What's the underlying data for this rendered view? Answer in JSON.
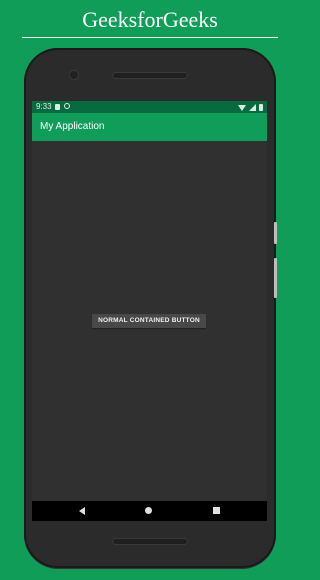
{
  "header": {
    "title": "GeeksforGeeks"
  },
  "device": {
    "status_bar": {
      "time": "9:33"
    },
    "app_bar": {
      "title": "My Application"
    },
    "main": {
      "button_label": "NORMAL CONTAINED BUTTON"
    },
    "nav": {
      "back": "back-icon",
      "home": "home-icon",
      "recents": "recents-icon"
    }
  },
  "colors": {
    "background": "#0f9d58",
    "app_bar": "#109d59",
    "status_bar": "#086a3f",
    "screen": "#303030",
    "button": "#484848"
  }
}
